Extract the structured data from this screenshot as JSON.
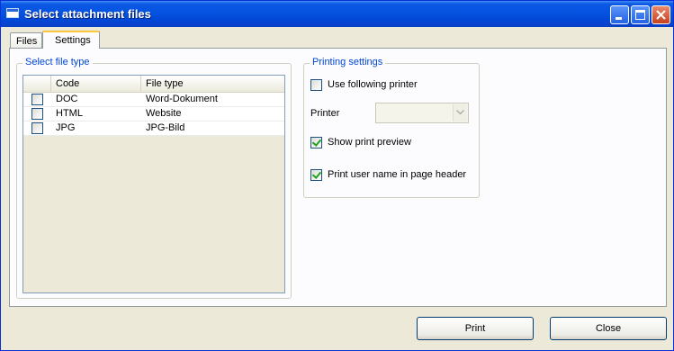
{
  "window": {
    "title": "Select attachment files"
  },
  "tabs": [
    {
      "label": "Files",
      "active": false
    },
    {
      "label": "Settings",
      "active": true
    }
  ],
  "file_type_group": {
    "legend": "Select file type",
    "columns": [
      "Code",
      "File type"
    ],
    "rows": [
      {
        "code": "DOC",
        "type": "Word-Dokument",
        "checked": false
      },
      {
        "code": "HTML",
        "type": "Website",
        "checked": false
      },
      {
        "code": "JPG",
        "type": "JPG-Bild",
        "checked": false
      }
    ]
  },
  "print_group": {
    "legend": "Printing settings",
    "use_printer": {
      "label": "Use following printer",
      "checked": false
    },
    "printer_label": "Printer",
    "printer_value": "",
    "show_preview": {
      "label": "Show print preview",
      "checked": true
    },
    "print_username": {
      "label": "Print user name in page header",
      "checked": true
    }
  },
  "buttons": {
    "print": "Print",
    "close": "Close"
  },
  "colors": {
    "titlebar": "#0553e0",
    "legend": "#0046d5",
    "dialog_bg": "#ece9d8"
  },
  "icons": [
    "app-window-icon",
    "minimize-icon",
    "maximize-icon",
    "close-icon",
    "chevron-down-icon"
  ]
}
